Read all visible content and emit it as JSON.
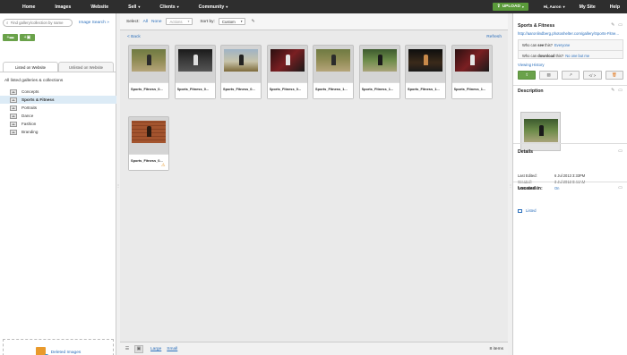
{
  "topnav": {
    "items": [
      {
        "label": "Home"
      },
      {
        "label": "Images"
      },
      {
        "label": "Website"
      },
      {
        "label": "Sell",
        "caret": "▾"
      },
      {
        "label": "Clients",
        "caret": "▾"
      },
      {
        "label": "Community",
        "caret": "▾"
      }
    ],
    "upload_label": "UPLOAD",
    "user_label": "Hi, Aaron",
    "user_caret": "▾",
    "my_site_label": "My Site",
    "help_label": "Help"
  },
  "left": {
    "search_placeholder": "Find gallery/collection by name",
    "image_search_label": "Image Search",
    "image_search_arrow": "»",
    "tab_listed": "Listed on Website",
    "tab_unlisted": "Unlisted on Website",
    "all_label": "All listed galleries & collections",
    "tree": [
      {
        "label": "Concepts"
      },
      {
        "label": "Sports & Fitness",
        "selected": true
      },
      {
        "label": "Portraits"
      },
      {
        "label": "Dance"
      },
      {
        "label": "Fashion"
      },
      {
        "label": "Branding"
      }
    ],
    "deleted_label": "Deleted Images"
  },
  "center": {
    "select_label": "Select:",
    "select_all": "All",
    "select_none": "None",
    "actions_label": "Actions",
    "sortby_label": "Sort by:",
    "sort_value": "Custom",
    "back_label": "< Back",
    "refresh_label": "Refresh",
    "thumbs": [
      {
        "caption": "Sports_Fitness_0...",
        "scene": "outdoor-trees"
      },
      {
        "caption": "Sports_Fitness_0...",
        "scene": "dark-stairs"
      },
      {
        "caption": "Sports_Fitness_0...",
        "scene": "field-sky"
      },
      {
        "caption": "Sports_Fitness_0...",
        "scene": "red-dark"
      },
      {
        "caption": "Sports_Fitness_1...",
        "scene": "outdoor-trees"
      },
      {
        "caption": "Sports_Fitness_1...",
        "scene": "jump-trees"
      },
      {
        "caption": "Sports_Fitness_1...",
        "scene": "dark-silhouette"
      },
      {
        "caption": "Sports_Fitness_1...",
        "scene": "red-dark"
      },
      {
        "caption": "Sports_Fitness_0...",
        "scene": "brick-warm",
        "warning": true
      }
    ],
    "view_large": "Large",
    "view_small": "Small",
    "count_label": "8 items"
  },
  "right": {
    "title": "Sports & Fitness",
    "url": "http://aaronlindberg.photoshelter.com/gallery/Sports-Fitne...",
    "perm_view_prefix": "Who can",
    "perm_view_verb": "see",
    "perm_view_suffix": "this?",
    "perm_view_value": "Everyone",
    "perm_download_prefix": "Who can",
    "perm_download_verb": "download",
    "perm_download_suffix": "this?",
    "perm_download_value": "No one but me",
    "viewing_history": "Viewing History",
    "embed_label": "</ >",
    "description_title": "Description",
    "details_title": "Details",
    "details": [
      {
        "key": "Last Edited:",
        "value": "6 Jul 2013 3:33PM"
      },
      {
        "key": "Created:",
        "value": "3 Jul 2013 8:44AM"
      },
      {
        "key": "Watermarks:",
        "value": "On",
        "link": true
      }
    ],
    "located_title": "Located in:",
    "located_value": "Listed"
  }
}
